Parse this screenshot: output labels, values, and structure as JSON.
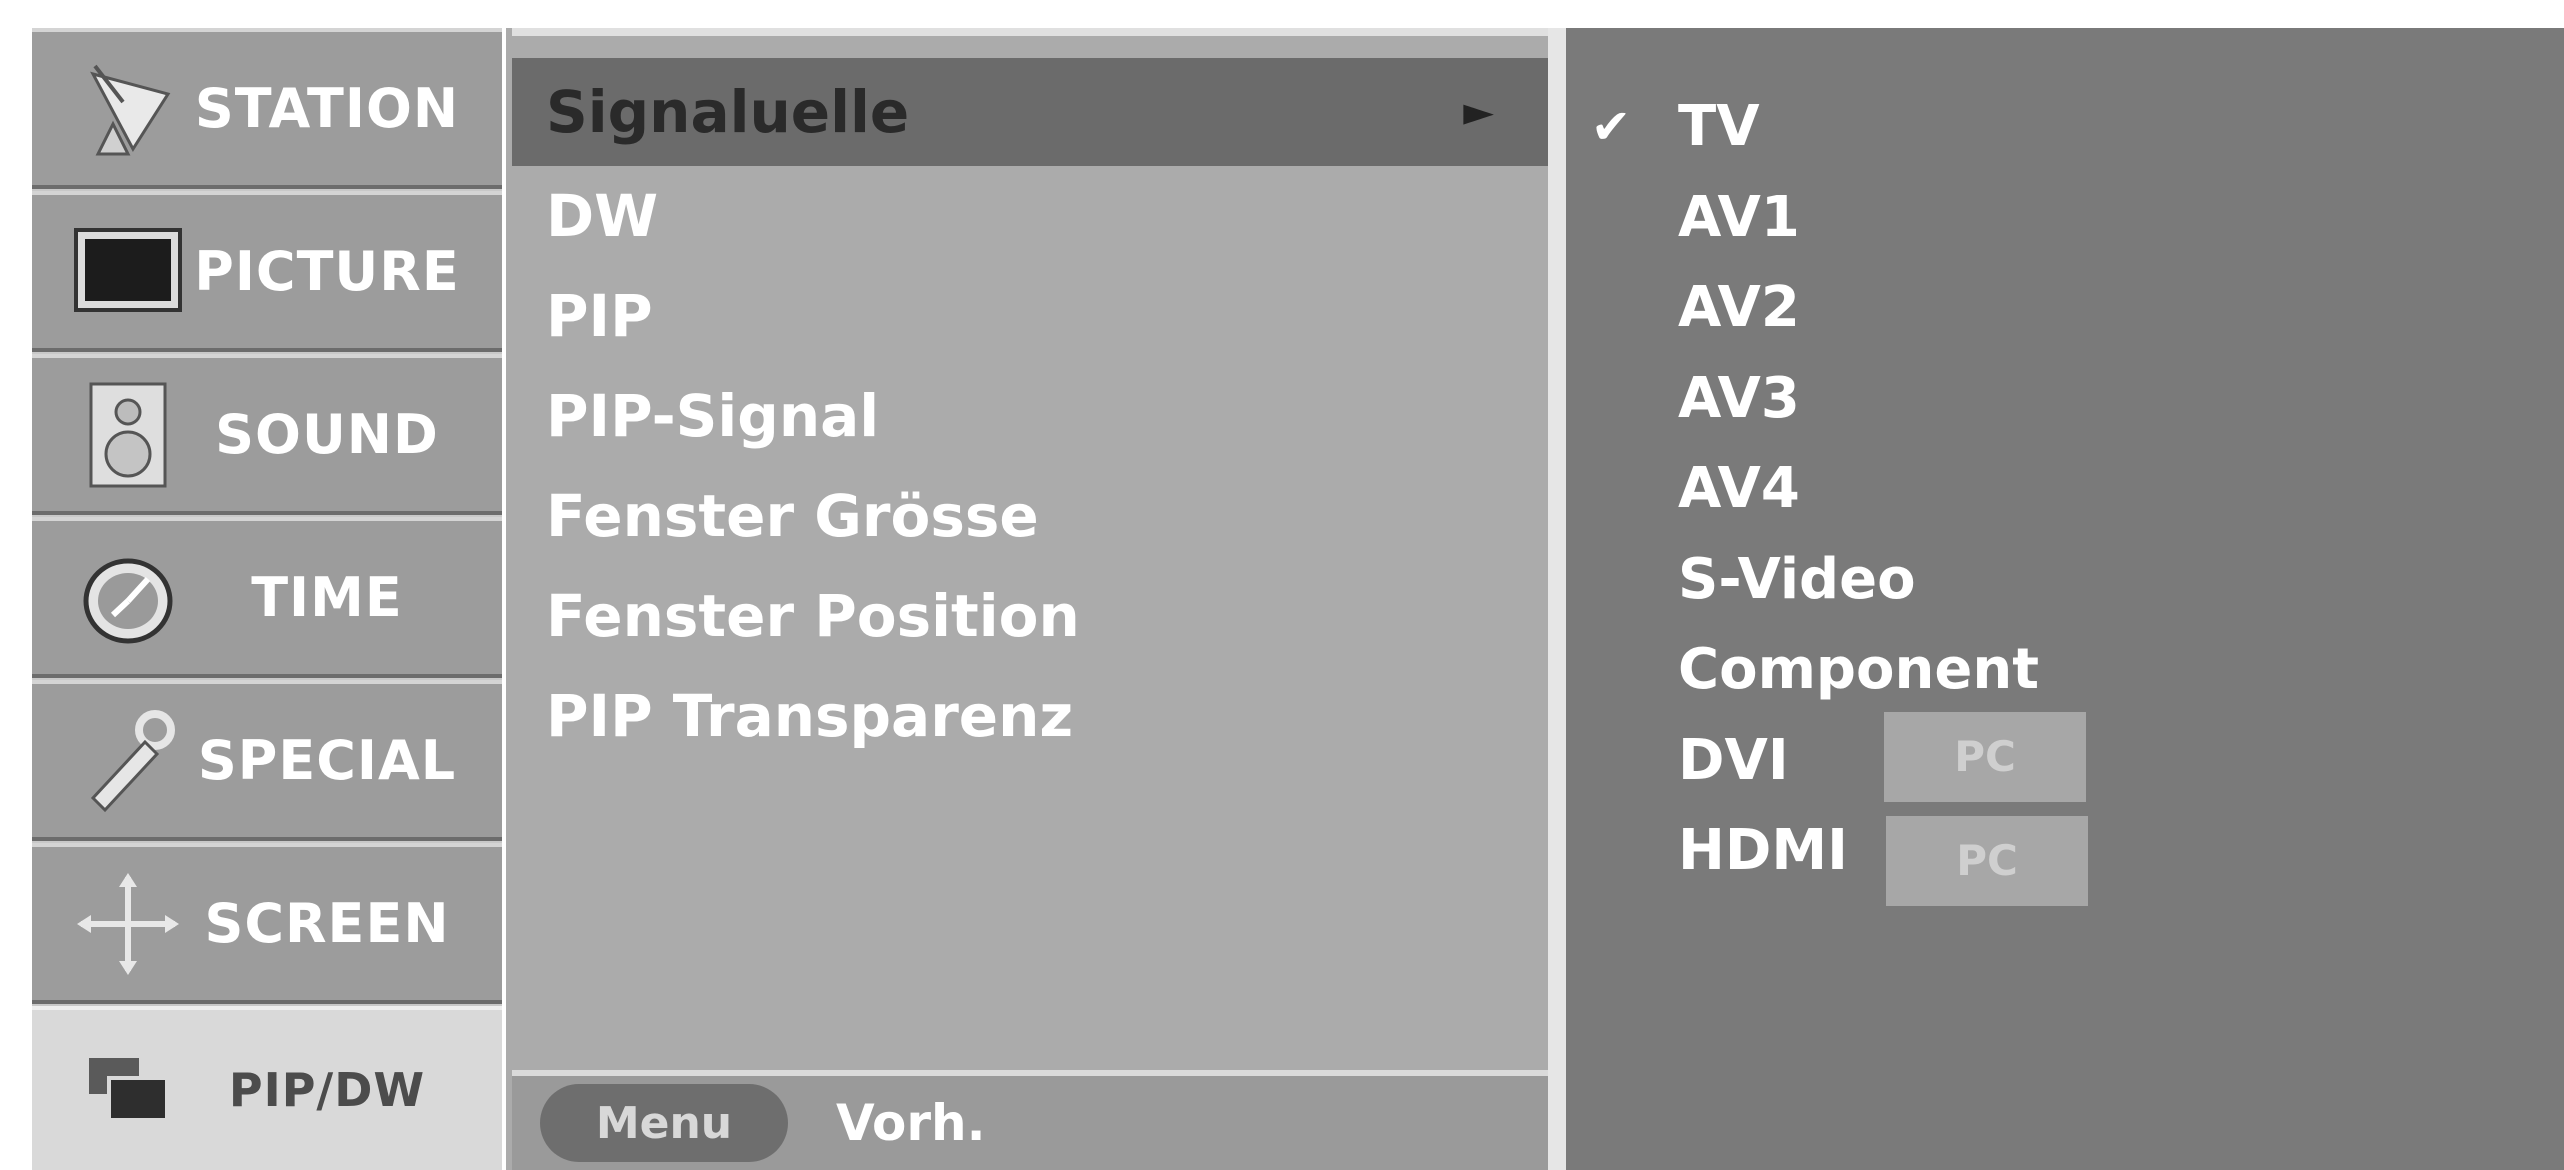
{
  "sidebar": {
    "items": [
      {
        "label": "STATION",
        "icon": "satellite-dish-icon"
      },
      {
        "label": "PICTURE",
        "icon": "tv-screen-icon"
      },
      {
        "label": "SOUND",
        "icon": "speaker-icon"
      },
      {
        "label": "TIME",
        "icon": "clock-icon"
      },
      {
        "label": "SPECIAL",
        "icon": "key-icon"
      },
      {
        "label": "SCREEN",
        "icon": "move-arrows-icon"
      },
      {
        "label": "PIP/DW",
        "icon": "pip-windows-icon"
      }
    ],
    "active": "PIP/DW"
  },
  "submenu": {
    "items": [
      {
        "label": "Signaluelle",
        "arrow": "►"
      },
      {
        "label": "DW"
      },
      {
        "label": "PIP"
      },
      {
        "label": "PIP-Signal"
      },
      {
        "label": "Fenster Grösse"
      },
      {
        "label": "Fenster Position"
      },
      {
        "label": "PIP Transparenz"
      }
    ],
    "selected": "Signaluelle"
  },
  "footer": {
    "menu_button": "Menu",
    "hint": "Vorh."
  },
  "sources": {
    "items": [
      {
        "label": "TV",
        "checked": true,
        "check_mark": "✔"
      },
      {
        "label": "AV1"
      },
      {
        "label": "AV2"
      },
      {
        "label": "AV3"
      },
      {
        "label": "AV4"
      },
      {
        "label": "S-Video"
      },
      {
        "label": "Component"
      },
      {
        "label": "DVI",
        "badge": "PC"
      },
      {
        "label": "HDMI",
        "badge": "PC"
      }
    ]
  },
  "colors": {
    "sidebar_item": "#9c9c9c",
    "sidebar_active": "#d9d9d9",
    "submenu_bg": "#ababab",
    "submenu_selected": "#6b6b6b",
    "sources_bg": "#7a7a7a",
    "badge_bg": "#a7a7a7"
  }
}
